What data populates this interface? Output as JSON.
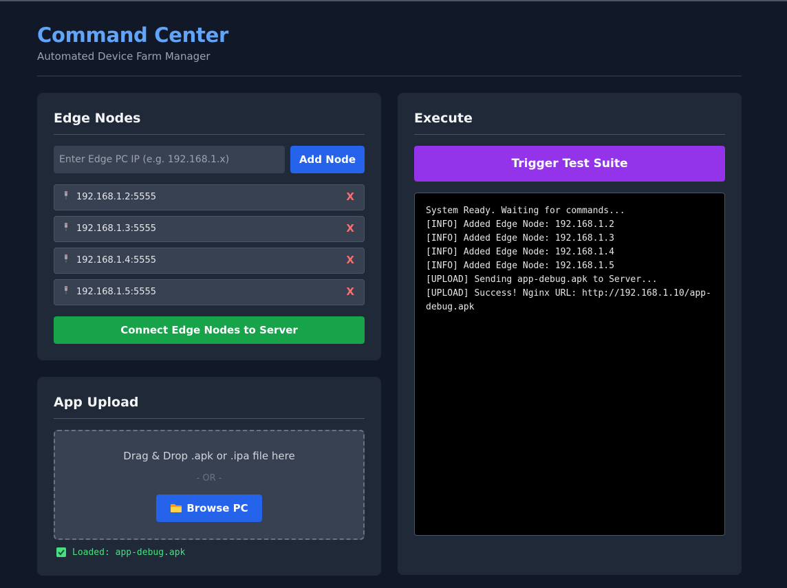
{
  "header": {
    "title": "Command Center",
    "subtitle": "Automated Device Farm Manager"
  },
  "edge_nodes": {
    "title": "Edge Nodes",
    "ip_placeholder": "Enter Edge PC IP (e.g. 192.168.1.x)",
    "add_label": "Add Node",
    "nodes": [
      {
        "ip": "192.168.1.2:5555",
        "remove_label": "X"
      },
      {
        "ip": "192.168.1.3:5555",
        "remove_label": "X"
      },
      {
        "ip": "192.168.1.4:5555",
        "remove_label": "X"
      },
      {
        "ip": "192.168.1.5:5555",
        "remove_label": "X"
      }
    ],
    "connect_label": "Connect Edge Nodes to Server"
  },
  "app_upload": {
    "title": "App Upload",
    "drop_text": "Drag & Drop .apk or .ipa file here",
    "or_text": "- OR -",
    "browse_label": "Browse PC",
    "loaded_text": "Loaded: app-debug.apk"
  },
  "execute": {
    "title": "Execute",
    "trigger_label": "Trigger Test Suite",
    "log_lines": [
      "System Ready. Waiting for commands...",
      "[INFO] Added Edge Node: 192.168.1.2",
      "[INFO] Added Edge Node: 192.168.1.3",
      "[INFO] Added Edge Node: 192.168.1.4",
      "[INFO] Added Edge Node: 192.168.1.5",
      "[UPLOAD] Sending app-debug.apk to Server...",
      "[UPLOAD] Success! Nginx URL: http://192.168.1.10/app-debug.apk"
    ]
  },
  "colors": {
    "accent_blue": "#2563eb",
    "title_blue": "#60a5fa",
    "success_green": "#16a34a",
    "trigger_purple": "#9333ea",
    "remove_red": "#f87171"
  },
  "icons": {
    "node": "device-icon",
    "browse": "folder-icon",
    "loaded": "check-icon"
  }
}
